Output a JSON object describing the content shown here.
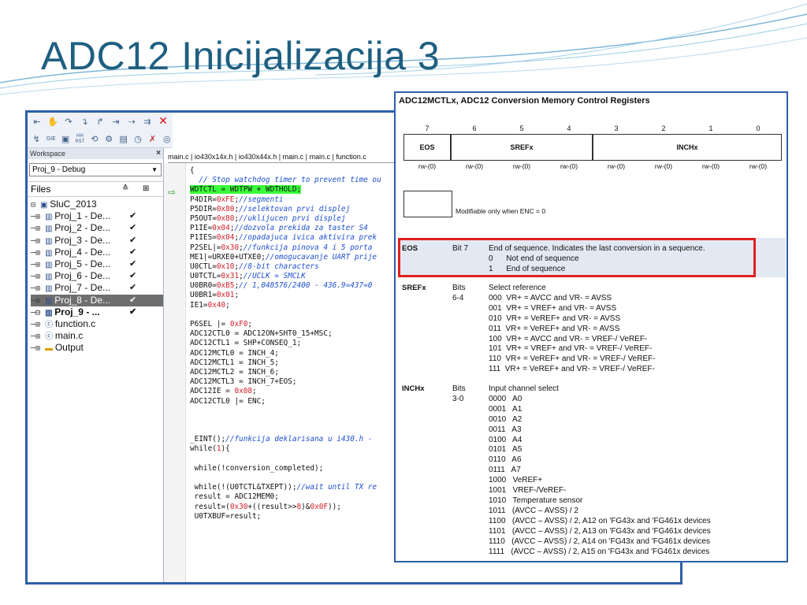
{
  "slide": {
    "title": "ADC12 Inicijalizacija 3"
  },
  "toolbar": {
    "row2_labels": [
      "GIE",
      "HH RST"
    ],
    "close_glyph": "✕"
  },
  "workspace": {
    "header": "Workspace",
    "close": "×",
    "config": "Proj_9 - Debug",
    "files_label": "Files",
    "tree": [
      {
        "label": "SluC_2013",
        "prefix": "⊟",
        "icon": "project-icon",
        "check": ""
      },
      {
        "label": "Proj_1 - De...",
        "prefix": "─⊞",
        "icon": "folder-icon",
        "check": "✔"
      },
      {
        "label": "Proj_2 - De...",
        "prefix": "─⊞",
        "icon": "folder-icon",
        "check": "✔"
      },
      {
        "label": "Proj_3 - De...",
        "prefix": "─⊞",
        "icon": "folder-icon",
        "check": "✔"
      },
      {
        "label": "Proj_4 - De...",
        "prefix": "─⊞",
        "icon": "folder-icon",
        "check": "✔"
      },
      {
        "label": "Proj_5 - De...",
        "prefix": "─⊞",
        "icon": "folder-icon",
        "check": "✔"
      },
      {
        "label": "Proj_6 - De...",
        "prefix": "─⊞",
        "icon": "folder-icon",
        "check": "✔"
      },
      {
        "label": "Proj_7 - De...",
        "prefix": "─⊞",
        "icon": "folder-icon",
        "check": "✔"
      },
      {
        "label": "Proj_8 - De...",
        "prefix": "─⊞",
        "icon": "folder-icon",
        "check": "✔",
        "selected": true
      },
      {
        "label": "Proj_9 - ...",
        "prefix": "─⊟",
        "icon": "folder-icon",
        "check": "✔",
        "bold": true
      },
      {
        "label": "function.c",
        "prefix": "  ─⊞",
        "icon": "c-file-icon",
        "check": ""
      },
      {
        "label": "main.c",
        "prefix": "  ─⊞",
        "icon": "c-file-icon",
        "check": ""
      },
      {
        "label": "Output",
        "prefix": "  ─⊞",
        "icon": "output-folder-icon",
        "check": ""
      }
    ]
  },
  "editor": {
    "tabs": "main.c | io430x14x.h | io430x44x.h | main.c | main.c | function.c",
    "code": [
      [
        {
          "t": "{"
        }
      ],
      [
        {
          "t": "  "
        },
        {
          "t": "// Stop watchdog timer to prevent time ou",
          "c": "com"
        }
      ],
      [
        {
          "t": "WDTCTL = WDTPW + WDTHOLD;",
          "c": "hl"
        }
      ],
      [
        {
          "t": "P4DIR="
        },
        {
          "t": "0xFE",
          "c": "num"
        },
        {
          "t": ";"
        },
        {
          "t": "//segmenti",
          "c": "com"
        }
      ],
      [
        {
          "t": "P5DIR="
        },
        {
          "t": "0x80",
          "c": "num"
        },
        {
          "t": ";"
        },
        {
          "t": "//selektovan prvi displej",
          "c": "com"
        }
      ],
      [
        {
          "t": "P5OUT="
        },
        {
          "t": "0x80",
          "c": "num"
        },
        {
          "t": ";"
        },
        {
          "t": "//uklijucen prvi displej",
          "c": "com"
        }
      ],
      [
        {
          "t": "P1IE="
        },
        {
          "t": "0x04",
          "c": "num"
        },
        {
          "t": ";"
        },
        {
          "t": "//dozvola prekida za taster S4",
          "c": "com"
        }
      ],
      [
        {
          "t": "P1IES="
        },
        {
          "t": "0x04",
          "c": "num"
        },
        {
          "t": ";"
        },
        {
          "t": "//opadajuca ivica aktivira prek",
          "c": "com"
        }
      ],
      [
        {
          "t": "P2SEL|="
        },
        {
          "t": "0x30",
          "c": "num"
        },
        {
          "t": ";"
        },
        {
          "t": "//funkcija pinova 4 i 5 porta",
          "c": "com"
        }
      ],
      [
        {
          "t": "ME1|=URXE0+UTXE0;"
        },
        {
          "t": "//omogucavanje UART prije",
          "c": "com"
        }
      ],
      [
        {
          "t": "U0CTL="
        },
        {
          "t": "0x10",
          "c": "num"
        },
        {
          "t": ";"
        },
        {
          "t": "//8-bit characters",
          "c": "com"
        }
      ],
      [
        {
          "t": "U0TCTL="
        },
        {
          "t": "0x31",
          "c": "num"
        },
        {
          "t": ";"
        },
        {
          "t": "//UCLK = SMCLK",
          "c": "com"
        }
      ],
      [
        {
          "t": "U0BR0="
        },
        {
          "t": "0xB5",
          "c": "num"
        },
        {
          "t": ";"
        },
        {
          "t": "// 1,048576/2400 - 436.9=437=0",
          "c": "com"
        }
      ],
      [
        {
          "t": "U0BR1="
        },
        {
          "t": "0x01",
          "c": "num"
        },
        {
          "t": ";"
        }
      ],
      [
        {
          "t": "IE1="
        },
        {
          "t": "0x40",
          "c": "num"
        },
        {
          "t": ";"
        }
      ],
      [
        {
          "t": ""
        }
      ],
      [
        {
          "t": "P6SEL |= "
        },
        {
          "t": "0xF0",
          "c": "num"
        },
        {
          "t": ";"
        }
      ],
      [
        {
          "t": "ADC12CTL0 = ADC12ON+SHT0_15+MSC;"
        }
      ],
      [
        {
          "t": "ADC12CTL1 = SHP+CONSEQ_1;"
        }
      ],
      [
        {
          "t": "ADC12MCTL0 = INCH_4;"
        }
      ],
      [
        {
          "t": "ADC12MCTL1 = INCH_5;"
        }
      ],
      [
        {
          "t": "ADC12MCTL2 = INCH_6;"
        }
      ],
      [
        {
          "t": "ADC12MCTL3 = INCH_7+EOS;"
        }
      ],
      [
        {
          "t": "ADC12IE = "
        },
        {
          "t": "0x08",
          "c": "num"
        },
        {
          "t": ";"
        }
      ],
      [
        {
          "t": "ADC12CTL0 |= ENC;"
        }
      ],
      [
        {
          "t": ""
        }
      ],
      [
        {
          "t": ""
        }
      ],
      [
        {
          "t": ""
        }
      ],
      [
        {
          "t": "_EINT();"
        },
        {
          "t": "//funkcija deklarisana u i430.h -",
          "c": "com"
        }
      ],
      [
        {
          "t": "while("
        },
        {
          "t": "1",
          "c": "num"
        },
        {
          "t": "){"
        }
      ],
      [
        {
          "t": ""
        }
      ],
      [
        {
          "t": " while(!conversion_completed);"
        }
      ],
      [
        {
          "t": ""
        }
      ],
      [
        {
          "t": " while(!(U0TCTL&TXEPT));"
        },
        {
          "t": "//wait until TX re",
          "c": "com"
        }
      ],
      [
        {
          "t": " result = ADC12MEM0;"
        }
      ],
      [
        {
          "t": " result=("
        },
        {
          "t": "0x30",
          "c": "num"
        },
        {
          "t": "+((result>>"
        },
        {
          "t": "8",
          "c": "num"
        },
        {
          "t": ")&"
        },
        {
          "t": "0x0F",
          "c": "num"
        },
        {
          "t": "));"
        }
      ],
      [
        {
          "t": " U0TXBUF=result;"
        }
      ]
    ]
  },
  "register": {
    "title": "ADC12MCTLx, ADC12 Conversion Memory Control Registers",
    "bit_numbers": [
      "7",
      "6",
      "5",
      "4",
      "3",
      "2",
      "1",
      "0"
    ],
    "fields": [
      "EOS",
      "SREFx",
      "INCHx"
    ],
    "rw": [
      "rw-(0)",
      "rw-(0)",
      "rw-(0)",
      "rw-(0)",
      "rw-(0)",
      "rw-(0)",
      "rw-(0)",
      "rw-(0)"
    ],
    "legend": "Modifiable only when ENC = 0",
    "eos": {
      "name": "EOS",
      "bits": "Bit 7",
      "lines": [
        "End of sequence. Indicates the last conversion in a sequence.",
        "0      Not end of sequence",
        "1      End of sequence"
      ]
    },
    "srefx": {
      "name": "SREFx",
      "bits": "Bits\n6-4",
      "lines": [
        "Select reference",
        "000  VR+ = AVCC and VR- = AVSS",
        "001  VR+ = VREF+ and VR- = AVSS",
        "010  VR+ = VeREF+ and VR- = AVSS",
        "011  VR+ = VeREF+ and VR- = AVSS",
        "100  VR+ = AVCC and VR- = VREF-/ VeREF-",
        "101  VR+ = VREF+ and VR- = VREF-/ VeREF-",
        "110  VR+ = VeREF+ and VR- = VREF-/ VeREF-",
        "111  VR+ = VeREF+ and VR- = VREF-/ VeREF-"
      ]
    },
    "inchx": {
      "name": "INCHx",
      "bits": "Bits\n3-0",
      "lines": [
        "Input channel select",
        "0000   A0",
        "0001   A1",
        "0010   A2",
        "0011   A3",
        "0100   A4",
        "0101   A5",
        "0110   A6",
        "0111   A7",
        "1000   VeREF+",
        "1001   VREF-/VeREF-",
        "1010   Temperature sensor",
        "1011   (AVCC – AVSS) / 2",
        "1100   (AVCC – AVSS) / 2, A12 on 'FG43x and 'FG461x devices",
        "1101   (AVCC – AVSS) / 2, A13 on 'FG43x and 'FG461x devices",
        "1110   (AVCC – AVSS) / 2, A14 on 'FG43x and 'FG461x devices",
        "1111   (AVCC – AVSS) / 2, A15 on 'FG43x and 'FG461x devices"
      ]
    }
  }
}
